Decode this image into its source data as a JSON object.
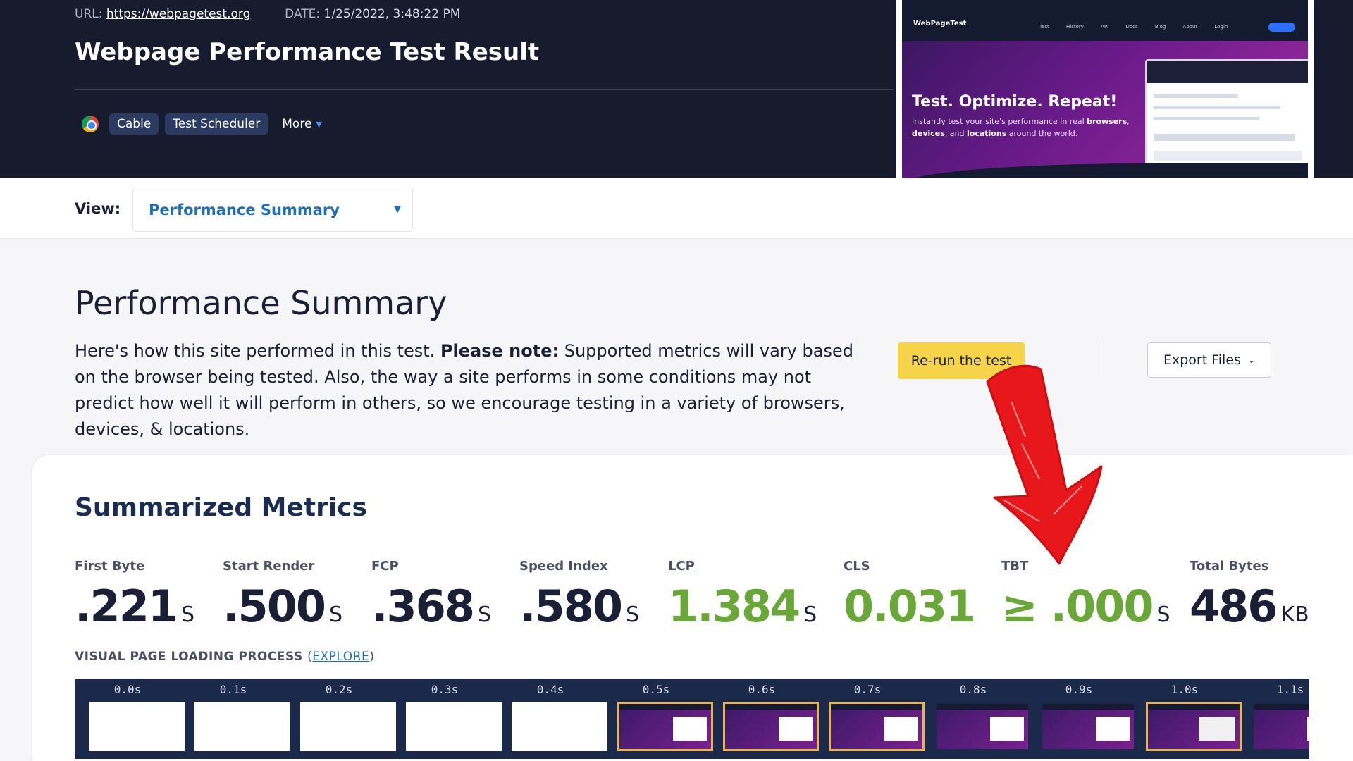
{
  "header": {
    "url_label": "URL:",
    "url": "https://webpagetest.org",
    "date_label": "DATE:",
    "date": "1/25/2022, 3:48:22 PM",
    "title": "Webpage Performance Test Result",
    "browser_icon": "chrome-icon",
    "tags": [
      "Cable",
      "Test Scheduler"
    ],
    "more_label": "More"
  },
  "thumbnail": {
    "logo": "WebPageTest",
    "nav_links": "Test History API Docs Blog About Login",
    "headline": "Test. Optimize. Repeat!",
    "text_pre": "Instantly test your site's performance in real ",
    "text_b1": "browsers",
    "text_mid1": ", ",
    "text_b2": "devices",
    "text_mid2": ", and ",
    "text_b3": "locations",
    "text_post": " around the world."
  },
  "view": {
    "label": "View:",
    "selected": "Performance Summary"
  },
  "summary": {
    "title": "Performance Summary",
    "desc_pre": "Here's how this site performed in this test. ",
    "desc_bold": "Please note:",
    "desc_post": " Supported metrics will vary based on the browser being tested. Also, the way a site performs in some conditions may not predict how well it will perform in others, so we encourage testing in a variety of browsers, devices, & locations.",
    "rerun_label": "Re-run the test",
    "export_label": "Export Files"
  },
  "metrics": {
    "title": "Summarized Metrics",
    "items": [
      {
        "label": "First Byte",
        "value": ".221",
        "unit": "S"
      },
      {
        "label": "Start Render",
        "value": ".500",
        "unit": "S"
      },
      {
        "label": "FCP",
        "value": ".368",
        "unit": "S"
      },
      {
        "label": "Speed Index",
        "value": ".580",
        "unit": "S"
      },
      {
        "label": "LCP",
        "value": "1.384",
        "unit": "S"
      },
      {
        "label": "CLS",
        "value": "0.031",
        "unit": ""
      },
      {
        "label": "TBT",
        "value": "≥ .000",
        "unit": "S"
      },
      {
        "label": "Total Bytes",
        "value": "486",
        "unit": "KB"
      }
    ]
  },
  "filmstrip": {
    "label": "VISUAL PAGE LOADING PROCESS",
    "explore_label": "EXPLORE",
    "frames": [
      "0.0s",
      "0.1s",
      "0.2s",
      "0.3s",
      "0.4s",
      "0.5s",
      "0.6s",
      "0.7s",
      "0.8s",
      "0.9s",
      "1.0s",
      "1.1s"
    ]
  },
  "colors": {
    "header_bg": "#161b2e",
    "accent_blue": "#1f6fb5",
    "rerun_yellow": "#f5d44a",
    "metric_good": "#6aa739",
    "annotation_red": "#e8171b"
  }
}
